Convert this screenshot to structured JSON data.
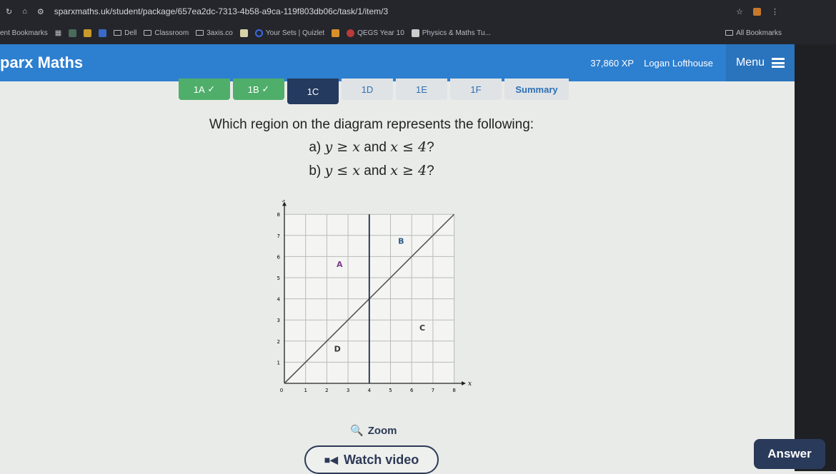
{
  "browser": {
    "url": "sparxmaths.uk/student/package/657ea2dc-7313-4b58-a9ca-119f803db06c/task/1/item/3",
    "bookmarks": [
      "ent Bookmarks",
      "Dell",
      "Classroom",
      "3axis.co",
      "Your Sets | Quizlet",
      "QEGS Year 10",
      "Physics & Maths Tu..."
    ],
    "all_bookmarks": "All Bookmarks"
  },
  "header": {
    "logo": "parx Maths",
    "xp": "37,860 XP",
    "user": "Logan Lofthouse",
    "menu": "Menu"
  },
  "tabs": [
    {
      "label": "1A",
      "done": true
    },
    {
      "label": "1B",
      "done": true
    },
    {
      "label": "1C",
      "active": true
    },
    {
      "label": "1D"
    },
    {
      "label": "1E"
    },
    {
      "label": "1F"
    },
    {
      "label": "Summary"
    }
  ],
  "question": {
    "prompt": "Which region on the diagram represents the following:",
    "a": {
      "prefix": "a)",
      "lhs": "y ≥ x",
      "and": "and",
      "rhs": "x ≤ 4",
      "q": "?"
    },
    "b": {
      "prefix": "b)",
      "lhs": "y ≤ x",
      "and": "and",
      "rhs": "x ≥ 4",
      "q": "?"
    }
  },
  "chart_data": {
    "type": "line",
    "xlabel": "x",
    "ylabel": "y",
    "xlim": [
      0,
      8
    ],
    "ylim": [
      0,
      8
    ],
    "grid": true,
    "xticks": [
      "0",
      "1",
      "2",
      "3",
      "4",
      "5",
      "6",
      "7",
      "8"
    ],
    "yticks": [
      "1",
      "2",
      "3",
      "4",
      "5",
      "6",
      "7",
      "8"
    ],
    "lines": [
      {
        "eq": "y = x",
        "points": [
          [
            0,
            0
          ],
          [
            8,
            8
          ]
        ]
      },
      {
        "eq": "x = 4",
        "points": [
          [
            4,
            0
          ],
          [
            4,
            8
          ]
        ]
      }
    ],
    "regions": [
      {
        "label": "A",
        "x": 2.6,
        "y": 5.5,
        "color": "#7a3d8c"
      },
      {
        "label": "B",
        "x": 5.5,
        "y": 6.6,
        "color": "#2a5c8c"
      },
      {
        "label": "C",
        "x": 6.5,
        "y": 2.5,
        "color": "#333333"
      },
      {
        "label": "D",
        "x": 2.5,
        "y": 1.5,
        "color": "#333333"
      }
    ]
  },
  "zoom": "Zoom",
  "watch": "Watch video",
  "answer": "Answer"
}
